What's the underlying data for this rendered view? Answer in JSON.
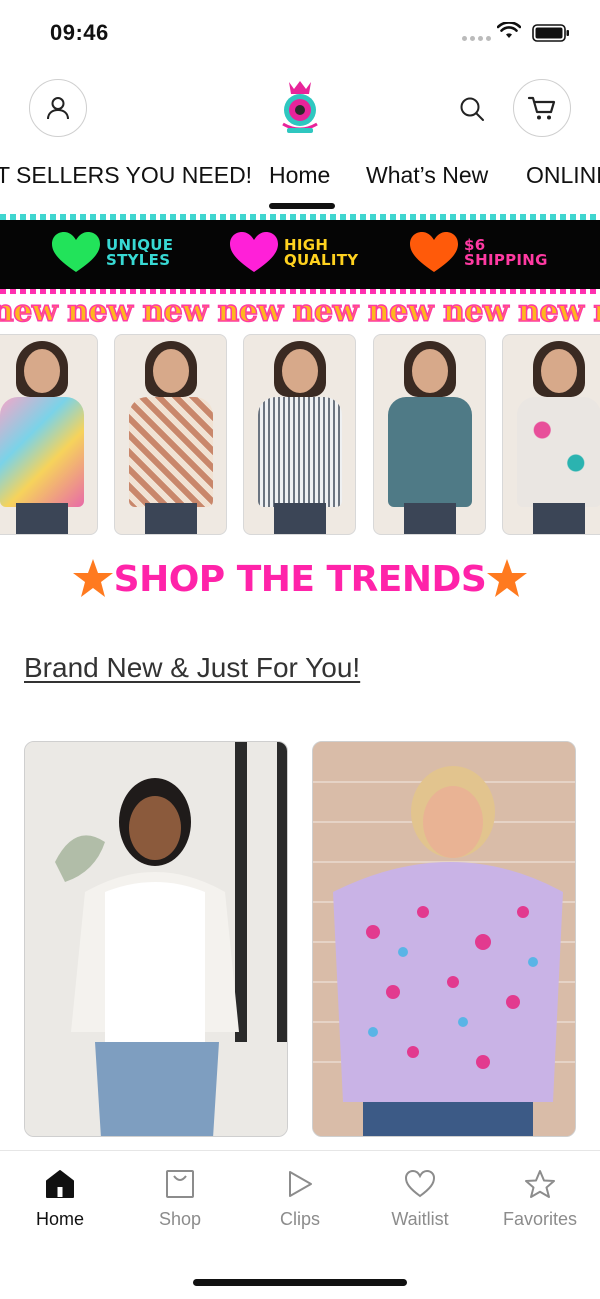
{
  "status_bar": {
    "time": "09:46"
  },
  "header": {
    "account_icon": "person-icon",
    "search_icon": "search-icon",
    "cart_icon": "cart-icon",
    "logo_icon": "brand-logo"
  },
  "nav": {
    "tabs": [
      {
        "label": "T SELLERS YOU NEED!"
      },
      {
        "label": "Home",
        "active": true
      },
      {
        "label": "What’s New"
      },
      {
        "label": "ONLINE"
      }
    ]
  },
  "promo": {
    "items": [
      {
        "text": "UNIQUE STYLES",
        "heart_color": "#22e35a",
        "text_color": "#38d9d4"
      },
      {
        "text": "HIGH QUALITY",
        "heart_color": "#ff20d8",
        "text_color": "#ffd21f"
      },
      {
        "text": "$6 SHIPPING",
        "heart_color": "#ff5a0a",
        "text_color": "#ff3aa2"
      }
    ]
  },
  "ribbon": {
    "text": "new new new new new new new new new"
  },
  "trends": {
    "title": "SHOP THE TRENDS",
    "title_color": "#ff23a9",
    "star_color": "#ff7a1f"
  },
  "section": {
    "title": "Brand New & Just For You!"
  },
  "tab_bar": {
    "items": [
      {
        "label": "Home",
        "icon": "home-icon",
        "active": true
      },
      {
        "label": "Shop",
        "icon": "shopping-bag-icon"
      },
      {
        "label": "Clips",
        "icon": "play-icon"
      },
      {
        "label": "Waitlist",
        "icon": "heart-icon"
      },
      {
        "label": "Favorites",
        "icon": "star-icon"
      }
    ]
  },
  "colors": {
    "accent": "#ff23a9",
    "banner_bg": "#050505"
  }
}
